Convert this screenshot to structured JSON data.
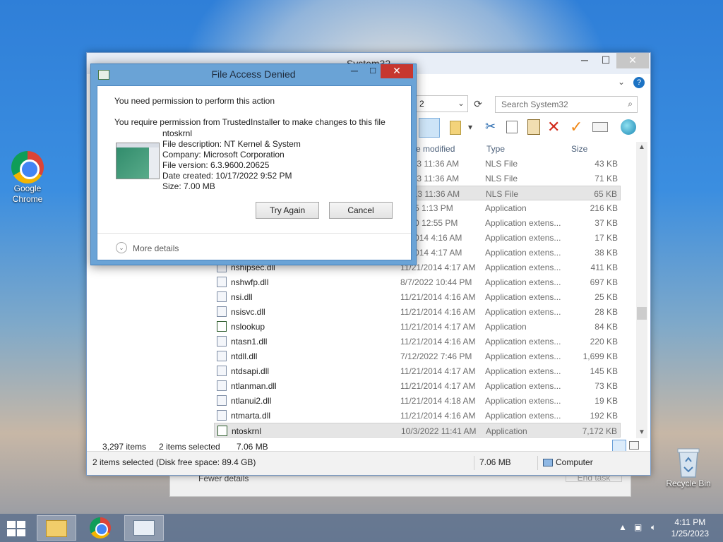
{
  "desktop": {
    "icons": [
      {
        "label_line1": "Google",
        "label_line2": "Chrome"
      },
      {
        "label": "Recycle Bin"
      }
    ]
  },
  "explorer": {
    "title": "System32",
    "address_fragment": "2",
    "search_placeholder": "Search System32",
    "columns": {
      "date": "e modified",
      "type": "Type",
      "size": "Size"
    },
    "rows": [
      {
        "name": "",
        "date": "/2013 11:36 AM",
        "type": "NLS File",
        "size": "43 KB"
      },
      {
        "name": "",
        "date": "/2013 11:36 AM",
        "type": "NLS File",
        "size": "71 KB"
      },
      {
        "name": "",
        "date": "/2013 11:36 AM",
        "type": "NLS File",
        "size": "65 KB",
        "selected": true
      },
      {
        "name": "",
        "date": "2015 1:13 PM",
        "type": "Application",
        "size": "216 KB"
      },
      {
        "name": "",
        "date": "2020 12:55 PM",
        "type": "Application extens...",
        "size": "37 KB"
      },
      {
        "name": "",
        "date": "/1/2014 4:16 AM",
        "type": "Application extens...",
        "size": "17 KB"
      },
      {
        "name": "",
        "date": "/1/2014 4:17 AM",
        "type": "Application extens...",
        "size": "38 KB"
      },
      {
        "name": "nshipsec.dll",
        "date": "11/21/2014 4:17 AM",
        "type": "Application extens...",
        "size": "411 KB"
      },
      {
        "name": "nshwfp.dll",
        "date": "8/7/2022 10:44 PM",
        "type": "Application extens...",
        "size": "697 KB"
      },
      {
        "name": "nsi.dll",
        "date": "11/21/2014 4:16 AM",
        "type": "Application extens...",
        "size": "25 KB"
      },
      {
        "name": "nsisvc.dll",
        "date": "11/21/2014 4:16 AM",
        "type": "Application extens...",
        "size": "28 KB"
      },
      {
        "name": "nslookup",
        "date": "11/21/2014 4:17 AM",
        "type": "Application",
        "size": "84 KB",
        "app": true
      },
      {
        "name": "ntasn1.dll",
        "date": "11/21/2014 4:16 AM",
        "type": "Application extens...",
        "size": "220 KB"
      },
      {
        "name": "ntdll.dll",
        "date": "7/12/2022 7:46 PM",
        "type": "Application extens...",
        "size": "1,699 KB"
      },
      {
        "name": "ntdsapi.dll",
        "date": "11/21/2014 4:17 AM",
        "type": "Application extens...",
        "size": "145 KB"
      },
      {
        "name": "ntlanman.dll",
        "date": "11/21/2014 4:17 AM",
        "type": "Application extens...",
        "size": "73 KB"
      },
      {
        "name": "ntlanui2.dll",
        "date": "11/21/2014 4:18 AM",
        "type": "Application extens...",
        "size": "19 KB"
      },
      {
        "name": "ntmarta.dll",
        "date": "11/21/2014 4:16 AM",
        "type": "Application extens...",
        "size": "192 KB"
      },
      {
        "name": "ntoskrnl",
        "date": "10/3/2022 11:41 AM",
        "type": "Application",
        "size": "7,172 KB",
        "selected": true,
        "app": true
      }
    ],
    "status": {
      "items": "3,297 items",
      "selected": "2 items selected",
      "selected_size": "7.06 MB"
    },
    "detail_bar": {
      "left": "2 items selected (Disk free space: 89.4 GB)",
      "mid": "7.06 MB",
      "right": "Computer"
    }
  },
  "behind_window": {
    "left": "Fewer details",
    "right": "End task"
  },
  "dialog": {
    "title": "File Access Denied",
    "line1": "You need permission to perform this action",
    "line2": "You require permission from TrustedInstaller to make changes to this file",
    "file_name": "ntoskrnl",
    "file_description": "File description: NT Kernel & System",
    "company": "Company: Microsoft Corporation",
    "file_version": "File version: 6.3.9600.20625",
    "date_created": "Date created: 10/17/2022 9:52 PM",
    "size": "Size: 7.00 MB",
    "try_again": "Try Again",
    "cancel": "Cancel",
    "more_details": "More details"
  },
  "taskbar": {
    "time": "4:11 PM",
    "date": "1/25/2023"
  }
}
